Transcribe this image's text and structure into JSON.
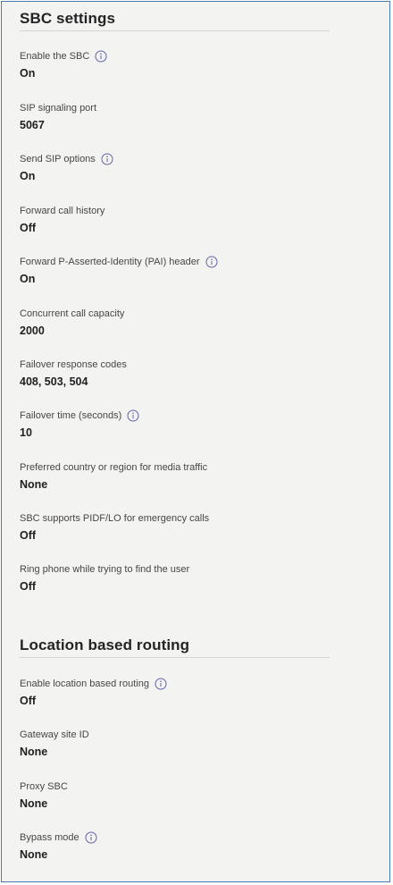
{
  "sections": [
    {
      "title": "SBC settings",
      "fields": [
        {
          "label": "Enable the SBC",
          "value": "On",
          "info": true
        },
        {
          "label": "SIP signaling port",
          "value": "5067",
          "info": false
        },
        {
          "label": "Send SIP options",
          "value": "On",
          "info": true
        },
        {
          "label": "Forward call history",
          "value": "Off",
          "info": false
        },
        {
          "label": "Forward P-Asserted-Identity (PAI) header",
          "value": "On",
          "info": true
        },
        {
          "label": "Concurrent call capacity",
          "value": "2000",
          "info": false
        },
        {
          "label": "Failover response codes",
          "value": "408, 503, 504",
          "info": false
        },
        {
          "label": "Failover time (seconds)",
          "value": "10",
          "info": true
        },
        {
          "label": "Preferred country or region for media traffic",
          "value": "None",
          "info": false
        },
        {
          "label": "SBC supports PIDF/LO for emergency calls",
          "value": "Off",
          "info": false
        },
        {
          "label": "Ring phone while trying to find the user",
          "value": "Off",
          "info": false
        }
      ]
    },
    {
      "title": "Location based routing",
      "fields": [
        {
          "label": "Enable location based routing",
          "value": "Off",
          "info": true
        },
        {
          "label": "Gateway site ID",
          "value": "None",
          "info": false
        },
        {
          "label": "Proxy SBC",
          "value": "None",
          "info": false
        },
        {
          "label": "Bypass mode",
          "value": "None",
          "info": true
        }
      ]
    }
  ],
  "colors": {
    "info_icon": "#6264a7",
    "background": "#f3f3f2",
    "frame_border": "#4a7bb0"
  },
  "icons": {
    "info": "info-icon"
  }
}
